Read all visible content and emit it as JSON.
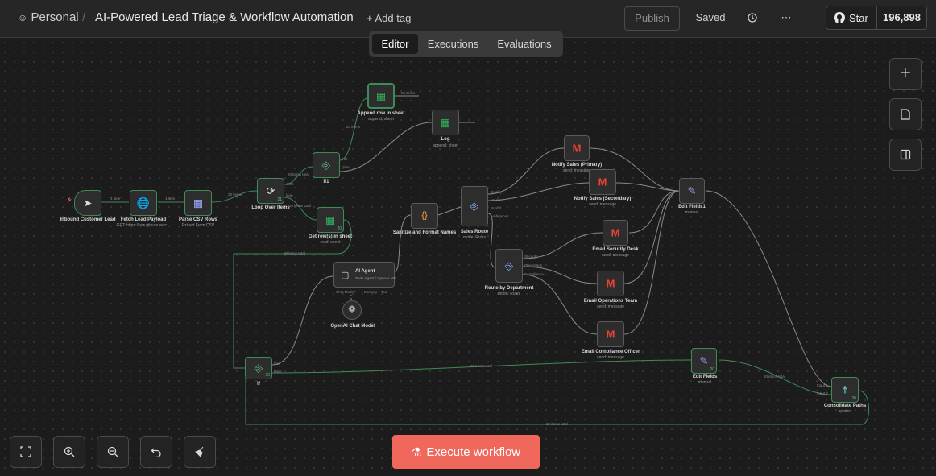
{
  "header": {
    "workspace": "Personal",
    "separator": "/",
    "workflow_title": "AI-Powered Lead Triage & Workflow Automation",
    "add_tag": "+ Add tag",
    "publish": "Publish",
    "saved": "Saved",
    "star_label": "Star",
    "star_count": "196,898"
  },
  "tabs": [
    {
      "label": "Editor",
      "active": true
    },
    {
      "label": "Executions",
      "active": false
    },
    {
      "label": "Evaluations",
      "active": false
    }
  ],
  "nodes": {
    "inbound": {
      "label": "Inbound Customer Lead",
      "sub": ""
    },
    "fetch": {
      "label": "Fetch Lead Payload",
      "sub": "GET: https://raw.githubuserc..."
    },
    "parse": {
      "label": "Parse CSV Rows",
      "sub": "Extract From CSV"
    },
    "loop": {
      "label": "Loop Over Items",
      "sub": "",
      "badge": "21"
    },
    "if1": {
      "label": "If1",
      "sub": ""
    },
    "append": {
      "label": "Append row in sheet",
      "sub": "append: sheet"
    },
    "log": {
      "label": "Log",
      "sub": "append: sheet"
    },
    "getrows": {
      "label": "Get row(s) in sheet",
      "sub": "read: sheet",
      "badge": "20"
    },
    "ai_agent": {
      "label": "AI Agent",
      "sub": "Tools Agent / OpenAI API..."
    },
    "openai": {
      "label": "OpenAI Chat Model",
      "sub": ""
    },
    "sanitize": {
      "label": "Sanitize and Format Names",
      "sub": ""
    },
    "sales_route": {
      "label": "Sales Route",
      "sub": "mode: Rules"
    },
    "route_dept": {
      "label": "Route by Department",
      "sub": "mode: Rules"
    },
    "notify_primary": {
      "label": "Notify Sales (Primary)",
      "sub": "send: message"
    },
    "notify_secondary": {
      "label": "Notify Sales (Secondary)",
      "sub": "send: message"
    },
    "email_security": {
      "label": "Email Security Desk",
      "sub": "send: message"
    },
    "email_ops": {
      "label": "Email Operations Team",
      "sub": "send: message"
    },
    "email_compliance": {
      "label": "Email Compliance Officer",
      "sub": "send: message"
    },
    "edit_fields1": {
      "label": "Edit Fields1",
      "sub": "manual"
    },
    "if": {
      "label": "If",
      "sub": "",
      "badge": "20"
    },
    "edit_fields": {
      "label": "Edit Fields",
      "sub": "manual",
      "badge": "20"
    },
    "consolidate": {
      "label": "Consolidate Paths",
      "sub": "append",
      "badge": "20"
    }
  },
  "edge_labels": {
    "e1": "1 item",
    "e2": "1 item",
    "e3": "20 items",
    "e4": "20 items total",
    "e5": "20 items",
    "e6": "20 items",
    "e7": "20 items total",
    "e8": "20 items total",
    "e9": "20 items total",
    "e10": "20 items total",
    "e11": "20 items total",
    "e12": "20 items"
  },
  "ports": {
    "loop_done": "done",
    "loop_loop": "loop",
    "if1_true": "true",
    "if1_false": "false",
    "sales_out": [
      "Quality",
      "Medium",
      "Bound",
      "Ambiguous"
    ],
    "dept_out": [
      "Security",
      "Operations",
      "Compliance"
    ],
    "agent_in": [
      "Chat Model*",
      "Memory",
      "Tool"
    ],
    "if_true": "true",
    "if_false": "false",
    "consolidate_in": [
      "Input 1",
      "Input 2"
    ]
  },
  "controls": {
    "execute": "Execute workflow"
  },
  "colors": {
    "accent": "#f0675b",
    "edge_success": "#3f8a58",
    "edge_default": "#8a8a8a",
    "canvas_bg": "#1c1c1c"
  },
  "icons": [
    "user-icon",
    "history-icon",
    "more-icon",
    "github-icon",
    "plus-icon",
    "sticky-note-icon",
    "panel-icon",
    "fit-view-icon",
    "zoom-in-icon",
    "zoom-out-icon",
    "undo-icon",
    "clean-up-icon",
    "flask-icon"
  ]
}
